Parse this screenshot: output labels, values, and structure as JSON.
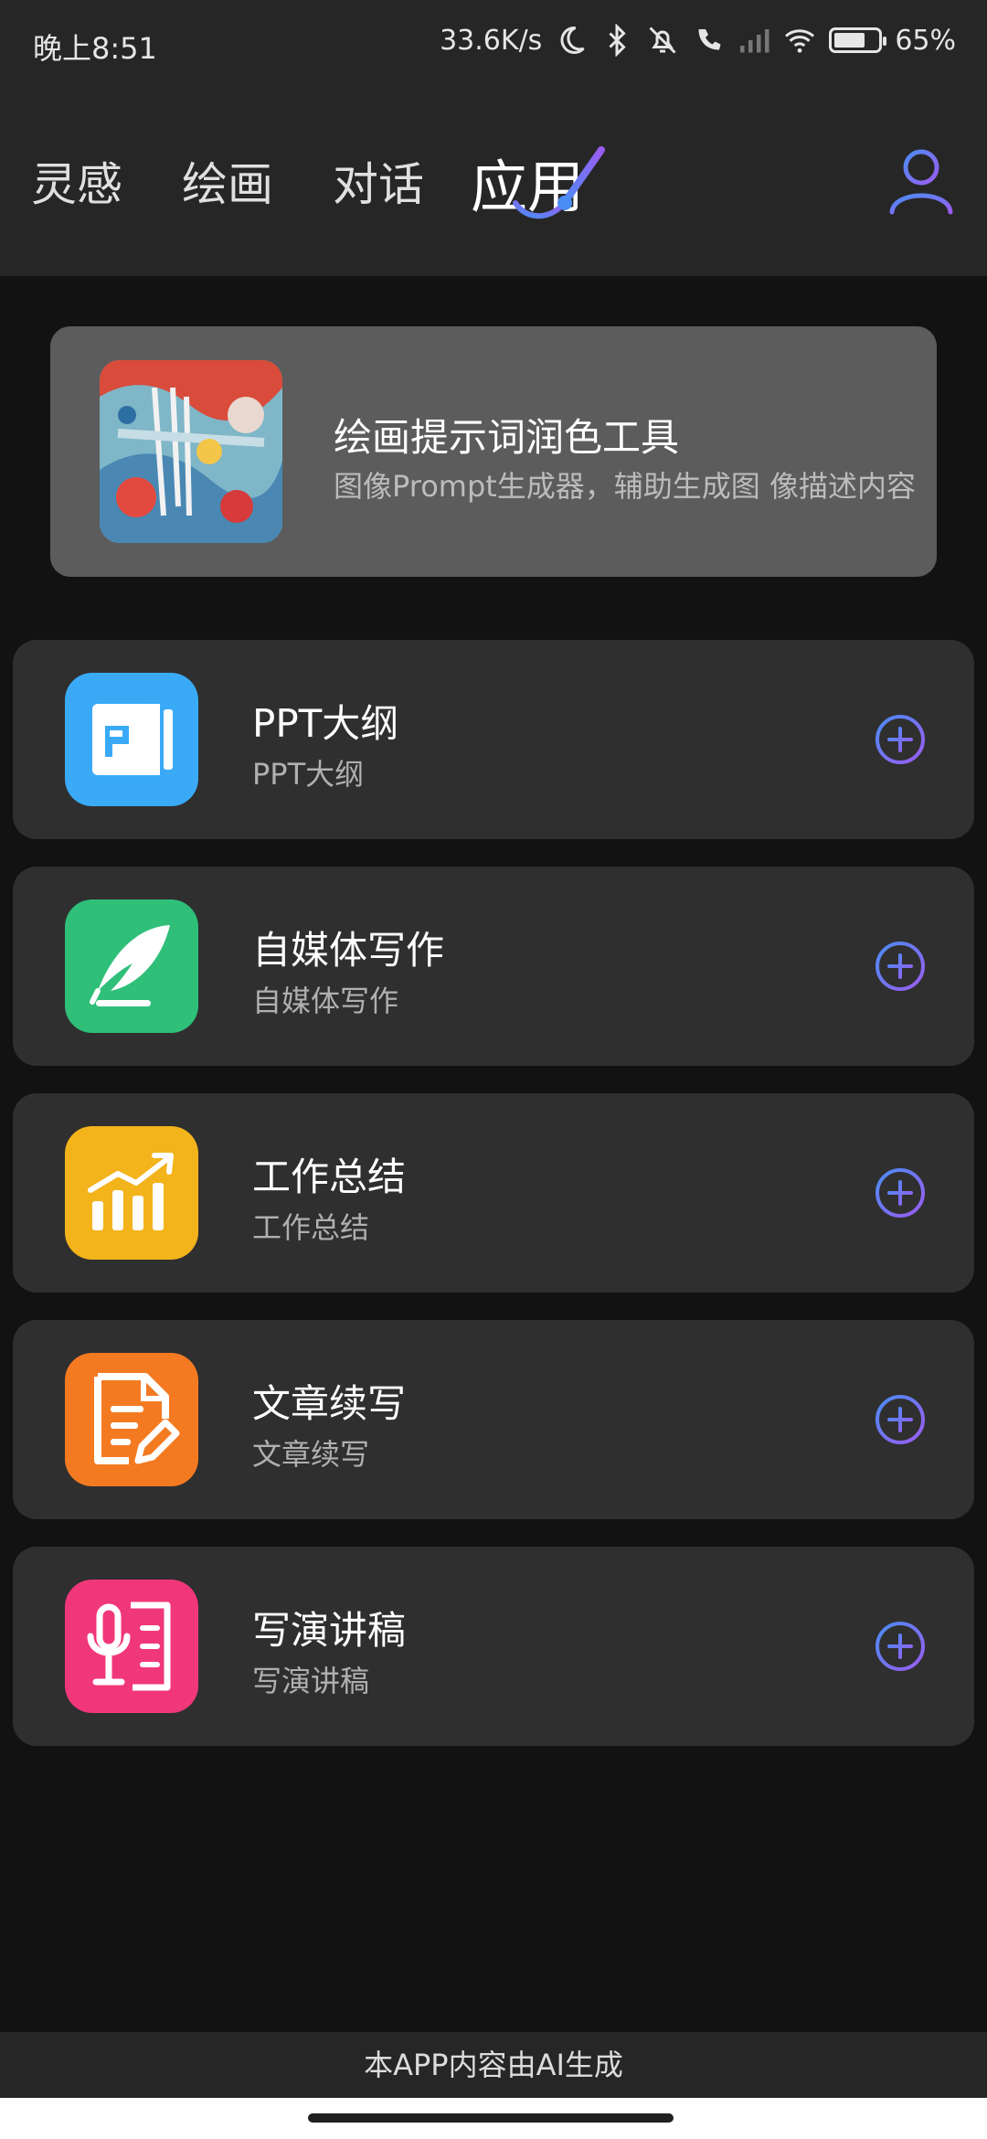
{
  "status_bar": {
    "time": "晚上8:51",
    "network_speed": "33.6K/s",
    "battery": "65%",
    "icons": [
      "moon-icon",
      "bluetooth-icon",
      "mute-icon",
      "call-icon",
      "signal-icon",
      "wifi-icon",
      "battery-icon"
    ]
  },
  "nav": {
    "tabs": [
      {
        "label": "灵感"
      },
      {
        "label": "绘画"
      },
      {
        "label": "对话"
      },
      {
        "label": "应用"
      }
    ],
    "active_tab": "应用",
    "profile_icon": "user-icon"
  },
  "featured": {
    "title": "绘画提示词润色工具",
    "description": "图像Prompt生成器，辅助生成图 像描述内容"
  },
  "apps": [
    {
      "title": "PPT大纲",
      "subtitle": "PPT大纲",
      "icon": "ppt-icon",
      "color": "#3aaaf7"
    },
    {
      "title": "自媒体写作",
      "subtitle": "自媒体写作",
      "icon": "feather-pen-icon",
      "color": "#2fbf79"
    },
    {
      "title": "工作总结",
      "subtitle": "工作总结",
      "icon": "bar-chart-icon",
      "color": "#f3b31b"
    },
    {
      "title": "文章续写",
      "subtitle": "文章续写",
      "icon": "document-edit-icon",
      "color": "#f47a22"
    },
    {
      "title": "写演讲稿",
      "subtitle": "写演讲稿",
      "icon": "microphone-doc-icon",
      "color": "#f0377a"
    }
  ],
  "footer": {
    "text": "本APP内容由AI生成"
  },
  "colors": {
    "accent_gradient_start": "#4a8df5",
    "accent_gradient_end": "#9b5cf0",
    "background": "#121212",
    "card": "#2f2f2f"
  }
}
